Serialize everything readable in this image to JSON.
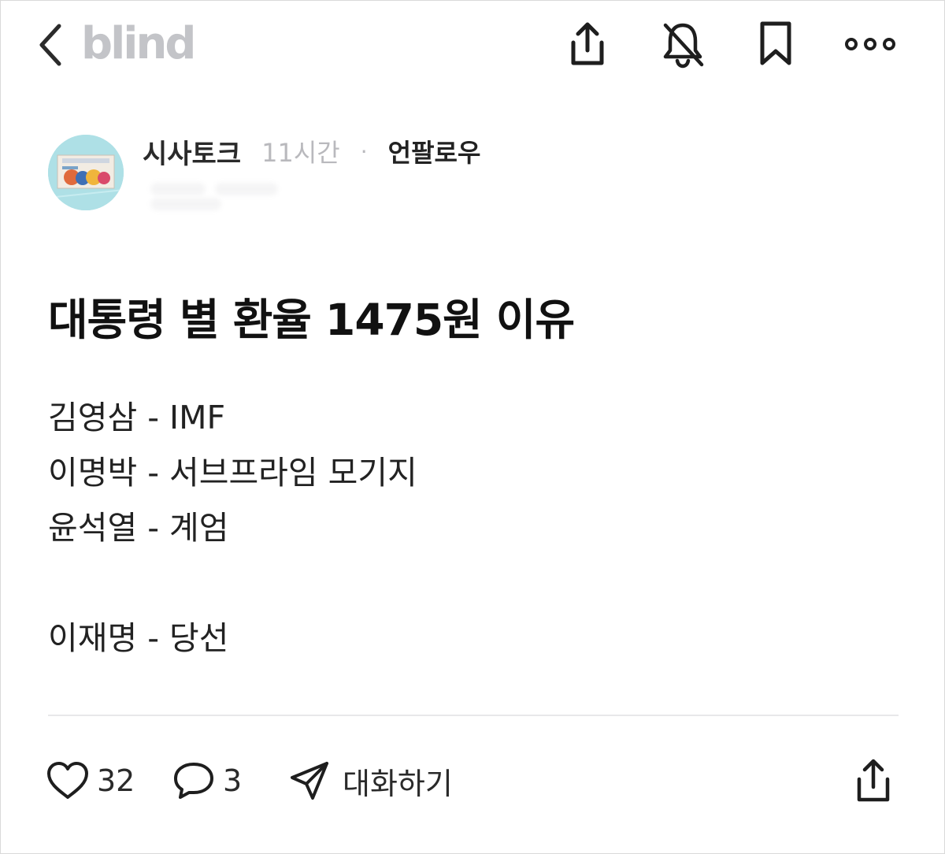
{
  "header": {
    "brand": "blind",
    "icons": [
      "back-icon",
      "share-icon",
      "bell-off-icon",
      "bookmark-icon",
      "more-icon"
    ]
  },
  "author": {
    "channel": "시사토크",
    "time": "11시간",
    "separator": "·",
    "follow_label": "언팔로우"
  },
  "post": {
    "title": "대통령 별 환율 1475원 이유",
    "lines": [
      "김영삼 - IMF",
      "이명박 - 서브프라임 모기지",
      "윤석열 - 계엄",
      "",
      "이재명 - 당선"
    ]
  },
  "actions": {
    "likes": "32",
    "comments": "3",
    "chat_label": "대화하기"
  },
  "colors": {
    "brand_gray": "#c3c4c8",
    "text": "#111111",
    "muted": "#b9b9bd",
    "divider": "#e8e8ea"
  }
}
